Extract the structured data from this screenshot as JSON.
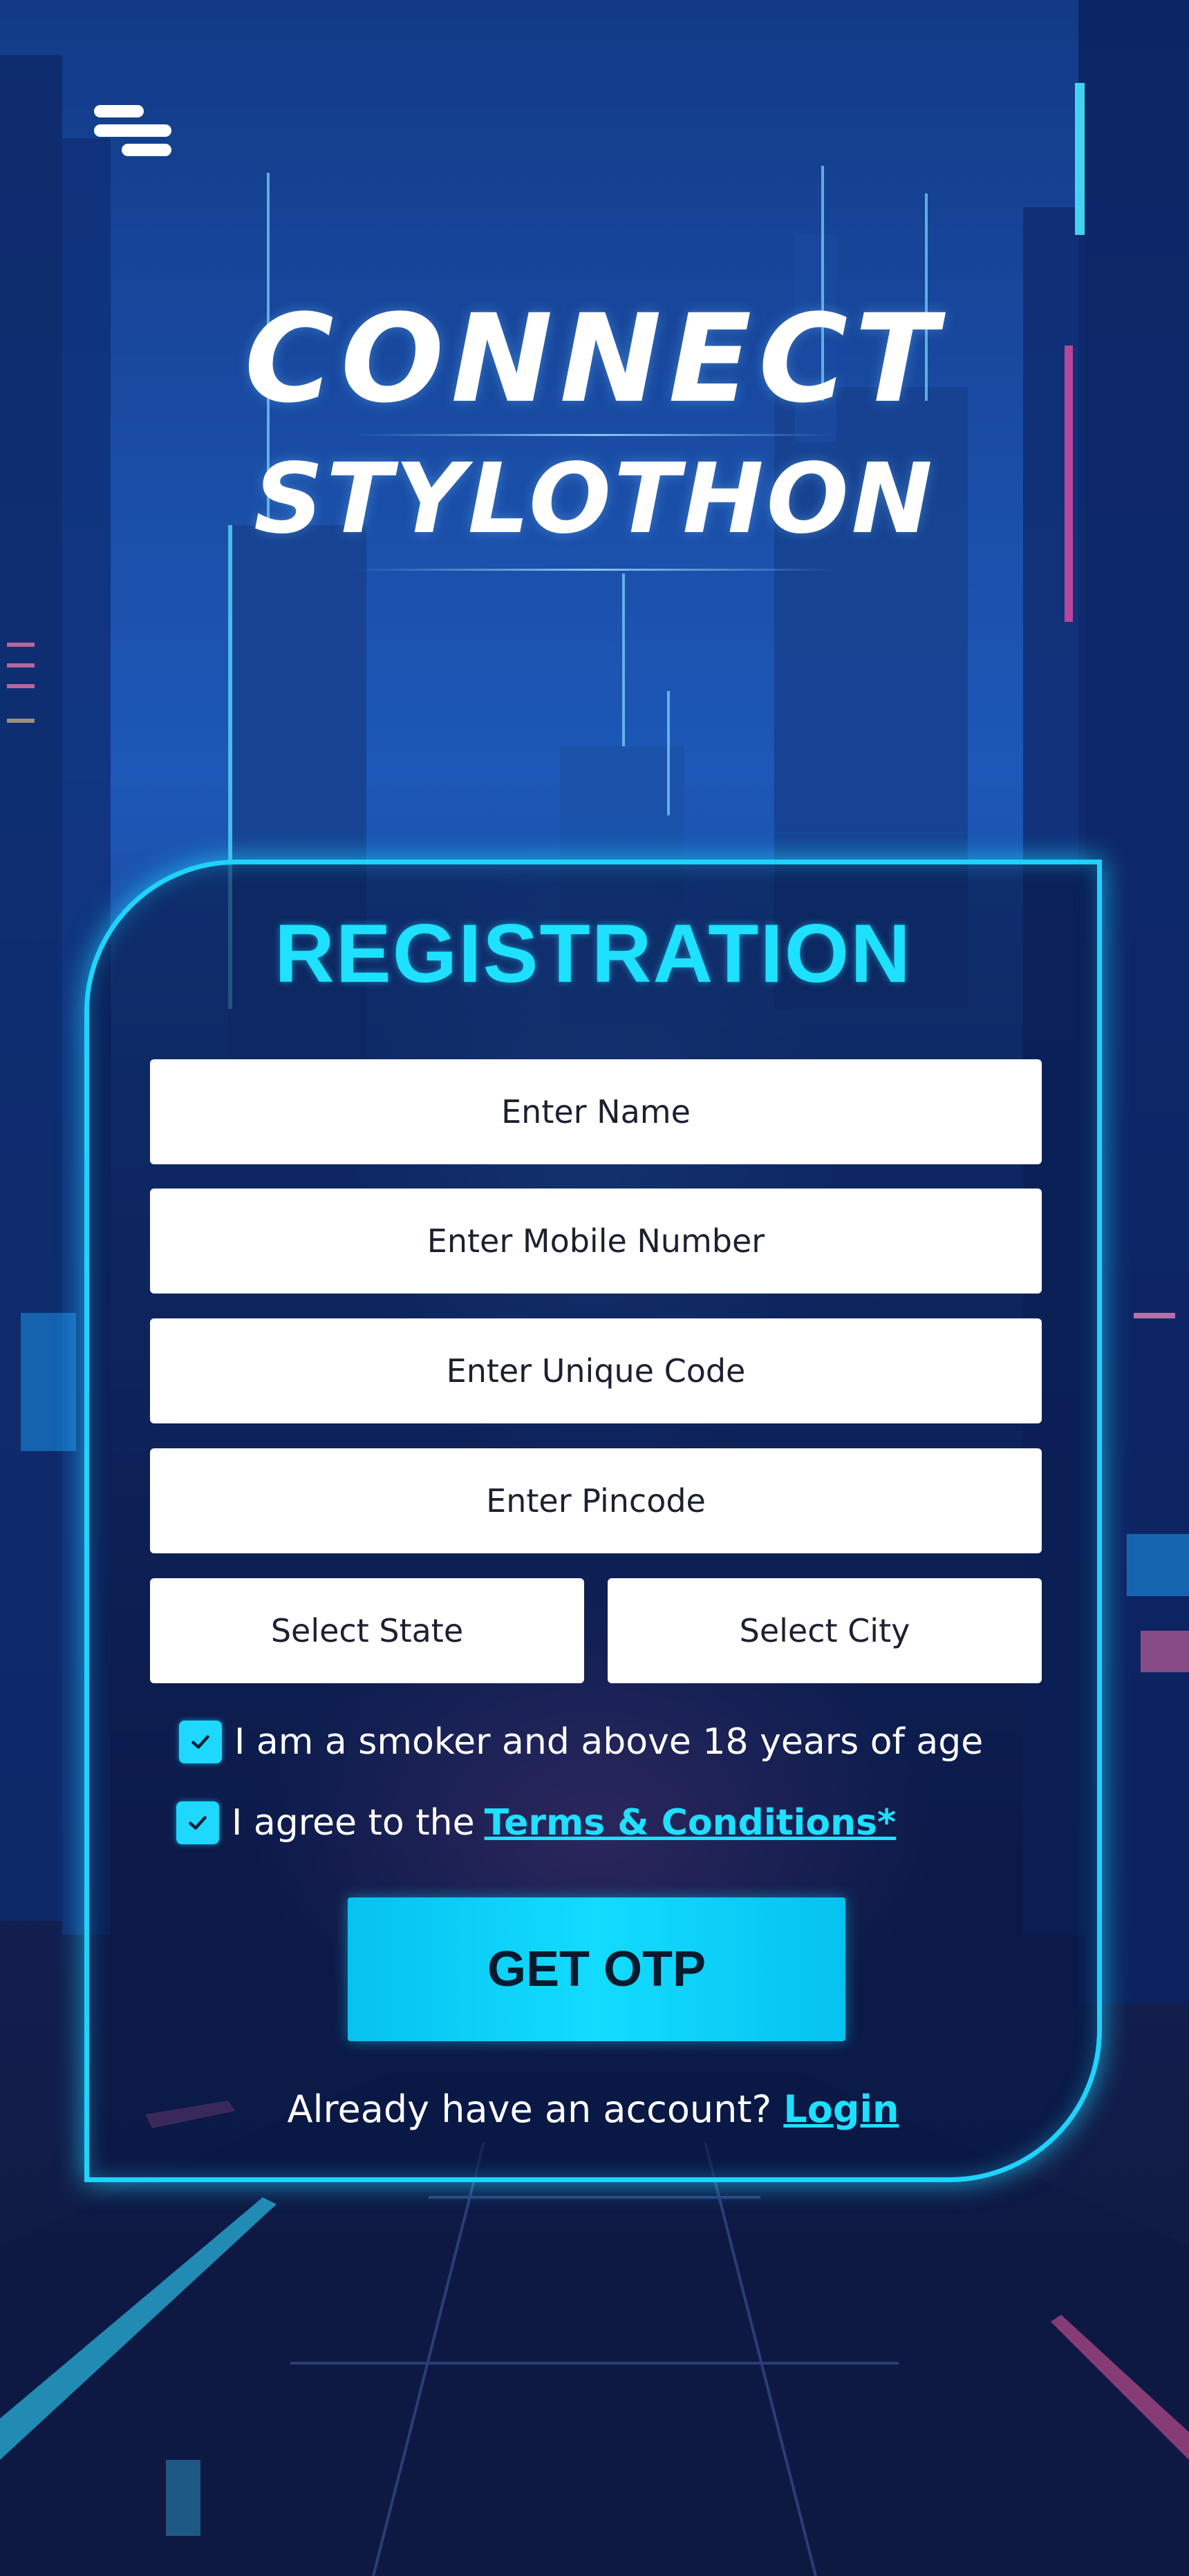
{
  "brand": {
    "line1": "CONNECT",
    "line2": "STYLOTHON"
  },
  "form": {
    "title": "REGISTRATION",
    "name_placeholder": "Enter Name",
    "mobile_placeholder": "Enter Mobile Number",
    "code_placeholder": "Enter Unique Code",
    "pincode_placeholder": "Enter Pincode",
    "state_label": "Select State",
    "city_label": "Select City",
    "smoker_label": "I am a smoker and above 18 years of age",
    "smoker_checked": true,
    "terms_prefix": "I agree to the",
    "terms_link": "Terms & Conditions*",
    "terms_checked": true,
    "submit_label": "GET OTP",
    "login_prompt": "Already have an account?",
    "login_link": "Login"
  },
  "icons": {
    "menu": "menu-icon",
    "check": "check-icon"
  },
  "colors": {
    "accent": "#1ee0ff",
    "button": "#12dcff",
    "card_border": "#1fd3ff"
  }
}
